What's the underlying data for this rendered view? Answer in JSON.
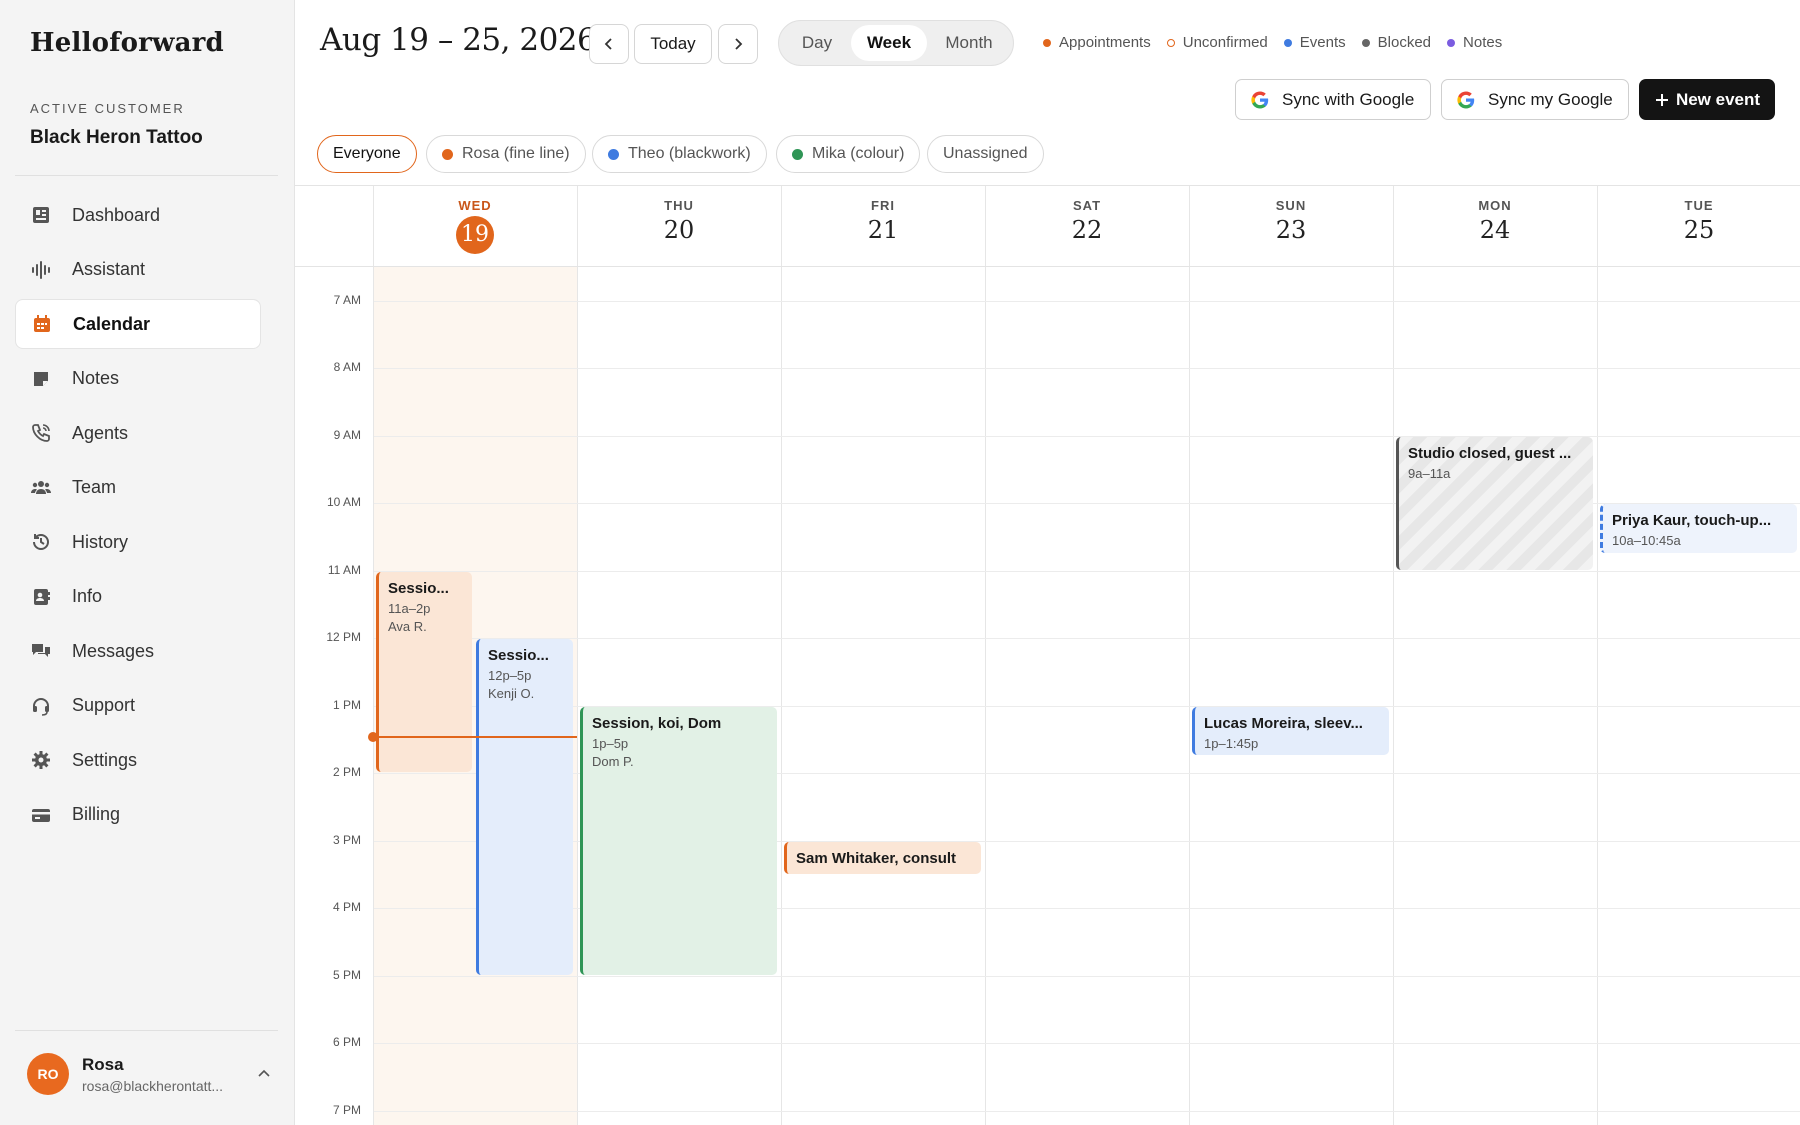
{
  "sidebar": {
    "brand": "Helloforward",
    "customer_label": "ACTIVE CUSTOMER",
    "customer_name": "Black Heron Tattoo",
    "items": [
      {
        "label": "Dashboard",
        "icon": "dashboard-icon"
      },
      {
        "label": "Assistant",
        "icon": "waveform-icon"
      },
      {
        "label": "Calendar",
        "icon": "calendar-icon",
        "active": true
      },
      {
        "label": "Notes",
        "icon": "note-icon"
      },
      {
        "label": "Agents",
        "icon": "phone-icon"
      },
      {
        "label": "Team",
        "icon": "team-icon"
      },
      {
        "label": "History",
        "icon": "history-icon"
      },
      {
        "label": "Info",
        "icon": "contact-card-icon"
      },
      {
        "label": "Messages",
        "icon": "chat-icon"
      },
      {
        "label": "Support",
        "icon": "headset-icon"
      },
      {
        "label": "Settings",
        "icon": "gear-icon"
      },
      {
        "label": "Billing",
        "icon": "credit-card-icon"
      }
    ],
    "user": {
      "initials": "RO",
      "name": "Rosa",
      "email": "rosa@blackherontatt..."
    }
  },
  "header": {
    "range": "Aug 19 – 25, 2026",
    "today": "Today",
    "views": [
      "Day",
      "Week",
      "Month"
    ],
    "active_view": "Week",
    "legend": [
      {
        "label": "Appointments",
        "color": "#e1661c",
        "style": "filled"
      },
      {
        "label": "Unconfirmed",
        "color": "#e1661c",
        "style": "outline"
      },
      {
        "label": "Events",
        "color": "#3f7be0",
        "style": "filled"
      },
      {
        "label": "Blocked",
        "color": "#666666",
        "style": "filled"
      },
      {
        "label": "Notes",
        "color": "#7b5ce0",
        "style": "filled"
      }
    ],
    "sync_google": "Sync with Google",
    "sync_my_google": "Sync my Google",
    "new_event": "New event"
  },
  "filters": [
    {
      "label": "Everyone",
      "active": true
    },
    {
      "label": "Rosa (fine line)",
      "color": "#e1661c"
    },
    {
      "label": "Theo (blackwork)",
      "color": "#3f7be0"
    },
    {
      "label": "Mika (colour)",
      "color": "#2f9556"
    },
    {
      "label": "Unassigned"
    }
  ],
  "days": [
    {
      "dow": "WED",
      "num": "19",
      "today": true
    },
    {
      "dow": "THU",
      "num": "20"
    },
    {
      "dow": "FRI",
      "num": "21"
    },
    {
      "dow": "SAT",
      "num": "22"
    },
    {
      "dow": "SUN",
      "num": "23"
    },
    {
      "dow": "MON",
      "num": "24"
    },
    {
      "dow": "TUE",
      "num": "25"
    }
  ],
  "hours": [
    "7 AM",
    "8 AM",
    "9 AM",
    "10 AM",
    "11 AM",
    "12 PM",
    "1 PM",
    "2 PM",
    "3 PM",
    "4 PM",
    "5 PM",
    "6 PM",
    "7 PM"
  ],
  "events": [
    {
      "day": 0,
      "start": 11,
      "end": 14,
      "title": "Sessio...",
      "time": "11a–2p",
      "who": "Ava R.",
      "kind": "orange",
      "lane": 0
    },
    {
      "day": 0,
      "start": 12,
      "end": 17,
      "title": "Sessio...",
      "time": "12p–5p",
      "who": "Kenji O.",
      "kind": "blue",
      "lane": 1
    },
    {
      "day": 1,
      "start": 13,
      "end": 17,
      "title": "Session, koi, Dom",
      "time": "1p–5p",
      "who": "Dom P.",
      "kind": "green"
    },
    {
      "day": 2,
      "start": 15,
      "end": 15.5,
      "title": "Sam Whitaker, consult",
      "time": "",
      "who": "",
      "kind": "orange"
    },
    {
      "day": 4,
      "start": 13,
      "end": 13.75,
      "title": "Lucas Moreira, sleev...",
      "time": "1p–1:45p",
      "who": "",
      "kind": "blue"
    },
    {
      "day": 5,
      "start": 9,
      "end": 11,
      "title": "Studio closed, guest ...",
      "time": "9a–11a",
      "who": "",
      "kind": "blocked"
    },
    {
      "day": 6,
      "start": 10,
      "end": 10.75,
      "title": "Priya Kaur, touch-up...",
      "time": "10a–10:45a",
      "who": "",
      "kind": "unconf"
    }
  ],
  "now": {
    "day": 0,
    "hour": 13.45
  }
}
